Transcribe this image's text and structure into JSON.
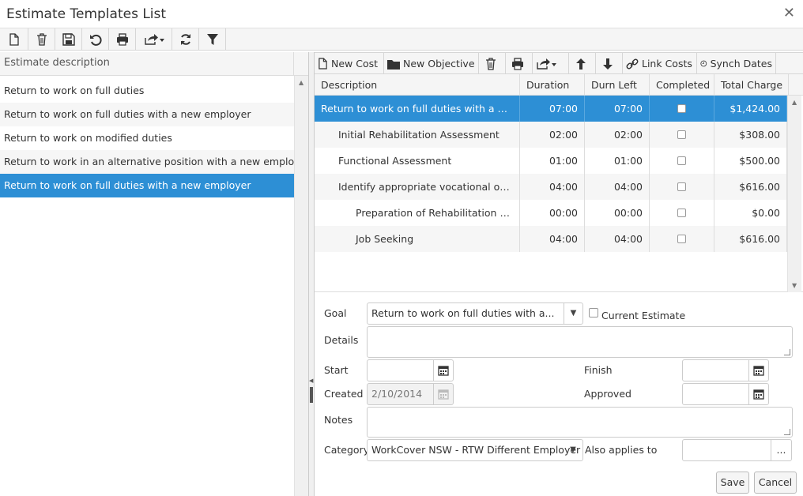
{
  "window": {
    "title": "Estimate Templates List",
    "close_glyph": "✕"
  },
  "main_toolbar": {
    "buttons": [
      "new-file-icon",
      "delete-icon",
      "save-icon",
      "undo-icon",
      "print-icon",
      "share-icon",
      "refresh-icon",
      "filter-icon"
    ]
  },
  "left": {
    "header": "Estimate description",
    "items": [
      "Return to work on full duties",
      "Return to work on full duties with a new employer",
      "Return to work on modified duties",
      "Return to work in an alternative position with a new employer",
      "Return to work on full duties with a new employer"
    ],
    "selected_index": 4
  },
  "right_toolbar": {
    "new_cost": "New Cost",
    "new_objective": "New Objective",
    "link_costs": "Link Costs",
    "synch_dates": "Synch Dates"
  },
  "grid": {
    "headers": [
      "Description",
      "Duration",
      "Durn Left",
      "Completed",
      "Total Charge"
    ],
    "rows": [
      {
        "description": "Return to work on full duties with a new employer",
        "duration": "07:00",
        "durn_left": "07:00",
        "completed": false,
        "total": "$1,424.00",
        "indent": 0
      },
      {
        "description": "Initial Rehabilitation Assessment",
        "duration": "02:00",
        "durn_left": "02:00",
        "completed": false,
        "total": "$308.00",
        "indent": 1
      },
      {
        "description": "Functional Assessment",
        "duration": "01:00",
        "durn_left": "01:00",
        "completed": false,
        "total": "$500.00",
        "indent": 1
      },
      {
        "description": "Identify appropriate vocational options",
        "duration": "04:00",
        "durn_left": "04:00",
        "completed": false,
        "total": "$616.00",
        "indent": 1
      },
      {
        "description": "Preparation of Rehabilitation Report",
        "duration": "00:00",
        "durn_left": "00:00",
        "completed": false,
        "total": "$0.00",
        "indent": 2
      },
      {
        "description": "Job Seeking",
        "duration": "04:00",
        "durn_left": "04:00",
        "completed": false,
        "total": "$616.00",
        "indent": 2
      }
    ]
  },
  "form": {
    "goal_label": "Goal",
    "goal_value": "Return to work on full duties with a...",
    "current_estimate_label": "Current Estimate",
    "details_label": "Details",
    "start_label": "Start",
    "start_value": "",
    "finish_label": "Finish",
    "finish_value": "",
    "created_label": "Created",
    "created_value": "2/10/2014",
    "approved_label": "Approved",
    "approved_value": "",
    "notes_label": "Notes",
    "category_label": "Category",
    "category_value": "WorkCover NSW - RTW Different Employer",
    "also_applies_label": "Also applies to",
    "also_applies_value": "",
    "ellipsis_glyph": "...",
    "save_label": "Save",
    "cancel_label": "Cancel"
  },
  "colors": {
    "selection": "#2d8fd5",
    "toolbar_bg": "#f5f5f5",
    "border": "#d6d6d6"
  }
}
